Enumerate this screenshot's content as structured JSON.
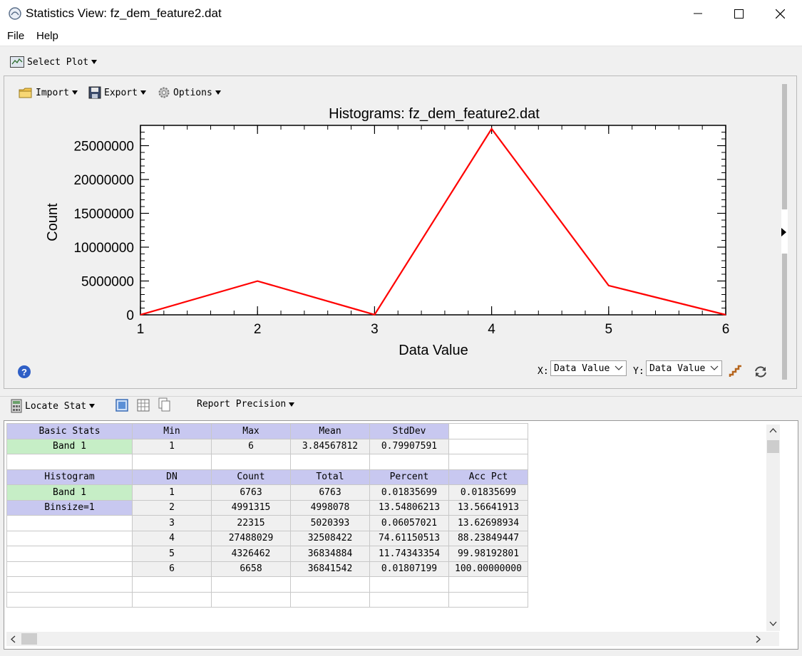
{
  "window": {
    "title": "Statistics View: fz_dem_feature2.dat"
  },
  "menu": {
    "file": "File",
    "help": "Help"
  },
  "toolbar": {
    "select_plot": "Select Plot"
  },
  "plot_toolbar": {
    "import": "Import",
    "export": "Export",
    "options": "Options"
  },
  "chart_data": {
    "type": "line",
    "title": "Histograms: fz_dem_feature2.dat",
    "xlabel": "Data Value",
    "ylabel": "Count",
    "x": [
      1,
      2,
      3,
      4,
      5,
      6
    ],
    "series": [
      {
        "color": "#ff0000",
        "values": [
          6763,
          4991315,
          22315,
          27488029,
          4326462,
          6658
        ]
      }
    ],
    "xlim": [
      1,
      6
    ],
    "ylim": [
      0,
      28000000
    ],
    "xticks": [
      1,
      2,
      3,
      4,
      5,
      6
    ],
    "yticks": [
      0,
      5000000,
      10000000,
      15000000,
      20000000,
      25000000
    ],
    "grid": false
  },
  "axis_selectors": {
    "x_label": "X:",
    "x_value": "Data Value",
    "y_label": "Y:",
    "y_value": "Data Value"
  },
  "stats_toolbar": {
    "locate_stat": "Locate Stat",
    "report_precision": "Report Precision"
  },
  "basic_stats": {
    "headers": [
      "Basic Stats",
      "Min",
      "Max",
      "Mean",
      "StdDev"
    ],
    "row": [
      "Band 1",
      "1",
      "6",
      "3.84567812",
      "0.79907591"
    ]
  },
  "histogram": {
    "headers": [
      "Histogram",
      "DN",
      "Count",
      "Total",
      "Percent",
      "Acc Pct"
    ],
    "rows": [
      [
        "Band 1",
        "1",
        "6763",
        "6763",
        "0.01835699",
        "0.01835699"
      ],
      [
        "Binsize=1",
        "2",
        "4991315",
        "4998078",
        "13.54806213",
        "13.56641913"
      ],
      [
        "",
        "3",
        "22315",
        "5020393",
        "0.06057021",
        "13.62698934"
      ],
      [
        "",
        "4",
        "27488029",
        "32508422",
        "74.61150513",
        "88.23849447"
      ],
      [
        "",
        "5",
        "4326462",
        "36834884",
        "11.74343354",
        "99.98192801"
      ],
      [
        "",
        "6",
        "6658",
        "36841542",
        "0.01807199",
        "100.00000000"
      ]
    ]
  }
}
